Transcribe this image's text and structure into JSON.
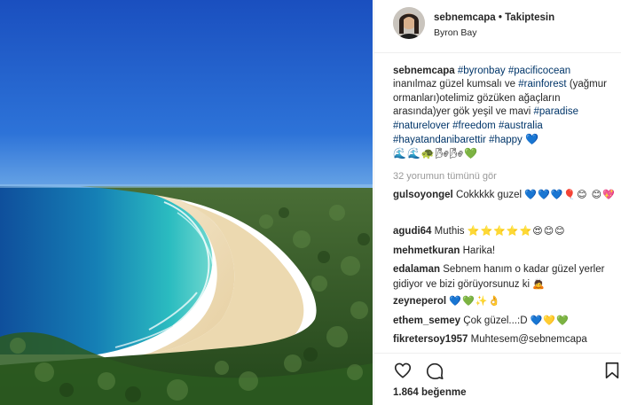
{
  "post": {
    "username": "sebnemcapa",
    "separator": "•",
    "follow_status": "Takiptesin",
    "location": "Byron Bay"
  },
  "caption": {
    "username": "sebnemcapa",
    "t1": "#byronbay",
    "t2": "#pacificocean",
    "p1": "inanılmaz güzel kumsalı ve",
    "t3": "#rainforest",
    "p2": "(yağmur ormanları)otelimiz gözüken ağaçların arasında)yer gök yeşil ve mavi",
    "t4": "#paradise",
    "t5": "#naturelover",
    "t6": "#freedom",
    "t7": "#australia",
    "t8": "#hayatandanibarettir",
    "t9": "#happy",
    "heart": "💙",
    "emojis": "🌊🌊🐢🌬🌬💚"
  },
  "view_all_comments": "32 yorumun tümünü gör",
  "comments": [
    {
      "username": "gulsoyongel",
      "text": "Cokkkkk guzel",
      "emojis": "💙💙💙🎈😊 😊💖"
    },
    {
      "username": "agudi64",
      "text": "Muthis",
      "emojis": "⭐⭐⭐⭐⭐😍😊😊"
    },
    {
      "username": "mehmetkuran",
      "text": "Harika!",
      "emojis": ""
    },
    {
      "username": "edalaman",
      "text": "Sebnem hanım o kadar güzel yerler gidiyor ve bizi görüyorsunuz ki",
      "emojis": "🙇"
    },
    {
      "username": "zeyneperol",
      "text": "",
      "emojis": "💙💚✨👌"
    },
    {
      "username": "ethem_semey",
      "text": "Çok güzel...:D",
      "emojis": "💙💛💚"
    },
    {
      "username": "fikretersoy1957",
      "text": "Muhtesem@sebnemcapa",
      "emojis": ""
    }
  ],
  "actions": {
    "like_icon": "heart-outline-icon",
    "comment_icon": "comment-bubble-icon",
    "save_icon": "bookmark-icon"
  },
  "likes": {
    "count": "1.864",
    "label": "beğenme"
  },
  "colors": {
    "text": "#262626",
    "hashtag": "#003569",
    "muted": "#999999",
    "border": "#efefef",
    "sky": "#1f5bc4",
    "ocean": "#1aa7b4",
    "forest": "#3d6b2a",
    "sand": "#efe0bf"
  }
}
